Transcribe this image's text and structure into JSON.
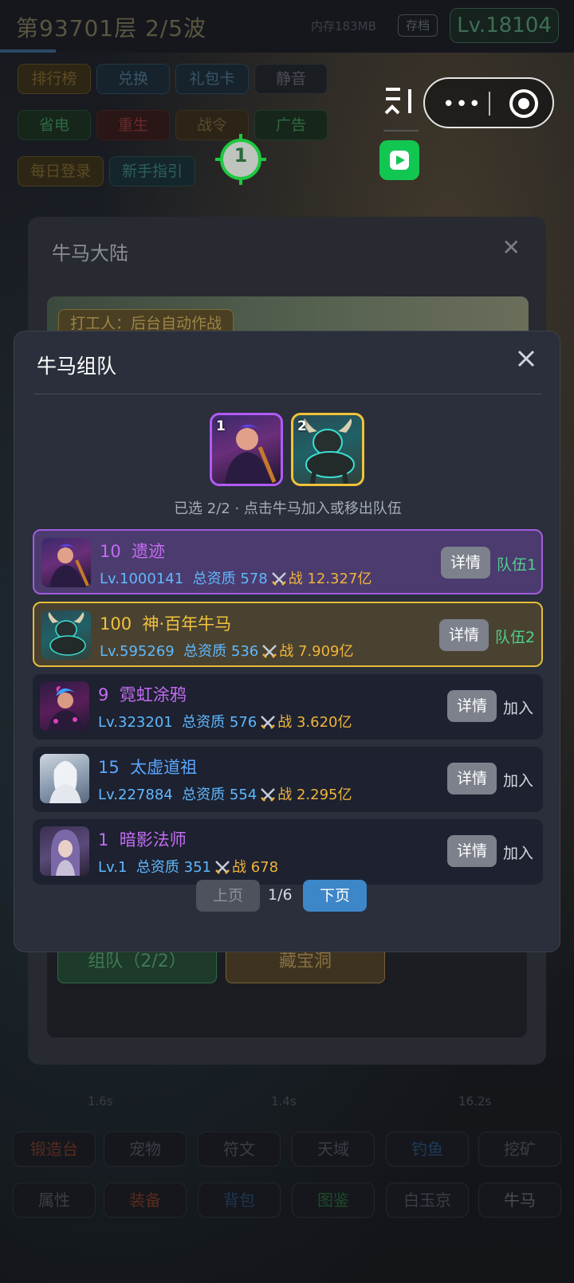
{
  "background": {
    "floor_title": "第93701层  2/5波",
    "memory": "内存183MB",
    "save_label": "存档",
    "level": "Lv.18104",
    "buttons_row1": [
      "排行榜",
      "兑换",
      "礼包卡",
      "静音"
    ],
    "buttons_row2": [
      "省电",
      "重生",
      "战令",
      "广告"
    ],
    "buttons_row3": [
      "每日登录",
      "新手指引"
    ],
    "target_number": "1",
    "bottom_row1": [
      "锻造台",
      "宠物",
      "符文",
      "天域",
      "钓鱼",
      "挖矿"
    ],
    "bottom_row2": [
      "属性",
      "装备",
      "背包",
      "图鉴",
      "白玉京",
      "牛马"
    ],
    "timers": [
      "1.6s",
      "1.4s",
      "16.2s"
    ]
  },
  "back_modal": {
    "title": "牛马大陆",
    "tag": "打工人：后台自动作战",
    "team_button": "组队（2/2）",
    "cave_button": "藏宝洞"
  },
  "modal": {
    "title": "牛马组队",
    "slots": [
      {
        "index": "1",
        "name": "遗迹"
      },
      {
        "index": "2",
        "name": "神·百年牛马"
      }
    ],
    "hint": "已选 2/2 · 点击牛马加入或移出队伍",
    "detail_label": "详情",
    "rows": [
      {
        "quality": "10",
        "name": "遗迹",
        "level": "Lv.1000141",
        "aptitude": "总资质 578",
        "power": "战 12.327亿",
        "action": "队伍1",
        "name_color": "#c46cf2"
      },
      {
        "quality": "100",
        "name": "神·百年牛马",
        "level": "Lv.595269",
        "aptitude": "总资质 536",
        "power": "战 7.909亿",
        "action": "队伍2",
        "name_color": "#f2c13c"
      },
      {
        "quality": "9",
        "name": "霓虹涂鸦",
        "level": "Lv.323201",
        "aptitude": "总资质 576",
        "power": "战 3.620亿",
        "action": "加入",
        "name_color": "#c46cf2"
      },
      {
        "quality": "15",
        "name": "太虚道祖",
        "level": "Lv.227884",
        "aptitude": "总资质 554",
        "power": "战 2.295亿",
        "action": "加入",
        "name_color": "#5aa6ff"
      },
      {
        "quality": "1",
        "name": "暗影法师",
        "level": "Lv.1",
        "aptitude": "总资质 351",
        "power": "战 678",
        "action": "加入",
        "name_color": "#c46cf2"
      }
    ],
    "pager": {
      "prev": "上页",
      "indicator": "1/6",
      "next": "下页"
    }
  },
  "colors": {
    "team_action": "#4fd08a",
    "join_action": "#d4d7de",
    "level_blue": "#5fb9ff",
    "power_gold": "#f0b43a"
  }
}
